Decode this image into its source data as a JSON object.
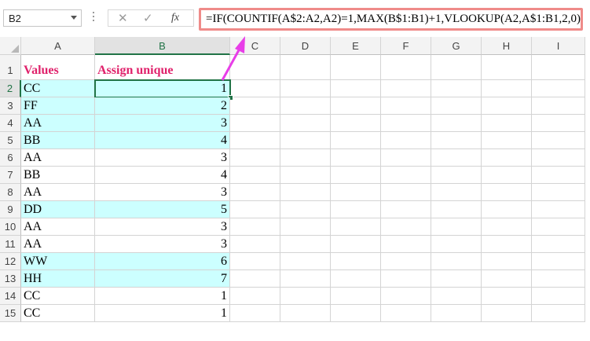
{
  "name_box": {
    "value": "B2"
  },
  "formula_bar": {
    "cancel_icon": "close-icon",
    "enter_icon": "check-icon",
    "function_label": "fx",
    "formula": "=IF(COUNTIF(A$2:A2,A2)=1,MAX(B$1:B1)+1,VLOOKUP(A2,A$1:B1,2,0))"
  },
  "columns": [
    "A",
    "B",
    "C",
    "D",
    "E",
    "F",
    "G",
    "H",
    "I"
  ],
  "selected_column": "B",
  "selected_row": "2",
  "rows": [
    {
      "num": "1",
      "a": "Values",
      "b": "Assign unique"
    },
    {
      "num": "2",
      "a": "CC",
      "b": "1"
    },
    {
      "num": "3",
      "a": "FF",
      "b": "2"
    },
    {
      "num": "4",
      "a": "AA",
      "b": "3"
    },
    {
      "num": "5",
      "a": "BB",
      "b": "4"
    },
    {
      "num": "6",
      "a": "AA",
      "b": "3"
    },
    {
      "num": "7",
      "a": "BB",
      "b": "4"
    },
    {
      "num": "8",
      "a": "AA",
      "b": "3"
    },
    {
      "num": "9",
      "a": "DD",
      "b": "5"
    },
    {
      "num": "10",
      "a": "AA",
      "b": "3"
    },
    {
      "num": "11",
      "a": "AA",
      "b": "3"
    },
    {
      "num": "12",
      "a": "WW",
      "b": "6"
    },
    {
      "num": "13",
      "a": "HH",
      "b": "7"
    },
    {
      "num": "14",
      "a": "CC",
      "b": "1"
    },
    {
      "num": "15",
      "a": "CC",
      "b": "1"
    }
  ],
  "colors": {
    "highlight_fill": "#ccffff",
    "header_text": "#e0216b",
    "formula_border": "#ef8b89",
    "arrow": "#e83ee8",
    "selection": "#217346"
  }
}
